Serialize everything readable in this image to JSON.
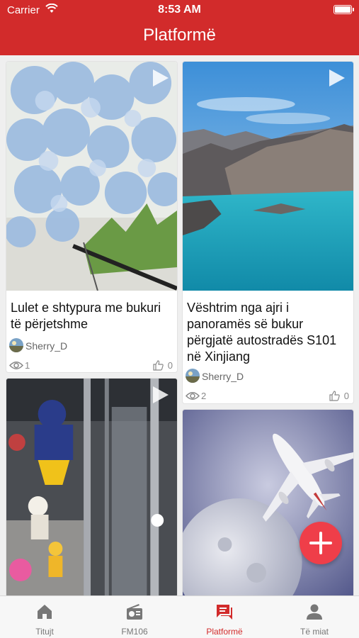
{
  "status_bar": {
    "carrier": "Carrier",
    "time": "8:53 AM"
  },
  "header": {
    "title": "Platformë"
  },
  "feed": [
    {
      "title": "Lulet e shtypura me bukuri të përjetshme",
      "author": "Sherry_D",
      "views": "1",
      "likes": "0"
    },
    {
      "title": "Vështrim nga ajri i panoramës së bukur përgjatë autostradës S101 në Xinjiang",
      "author": "Sherry_D",
      "views": "2",
      "likes": "0"
    }
  ],
  "fab": {
    "icon": "plus-icon"
  },
  "tabbar": {
    "tabs": [
      {
        "label": "Titujt",
        "icon": "home-icon"
      },
      {
        "label": "FM106",
        "icon": "radio-icon"
      },
      {
        "label": "Platformë",
        "icon": "chat-icon"
      },
      {
        "label": "Të miat",
        "icon": "person-icon"
      }
    ],
    "active_index": 2
  },
  "colors": {
    "brand": "#d22b2b",
    "fab": "#ef3e49",
    "active_tab": "#d22b2b"
  }
}
